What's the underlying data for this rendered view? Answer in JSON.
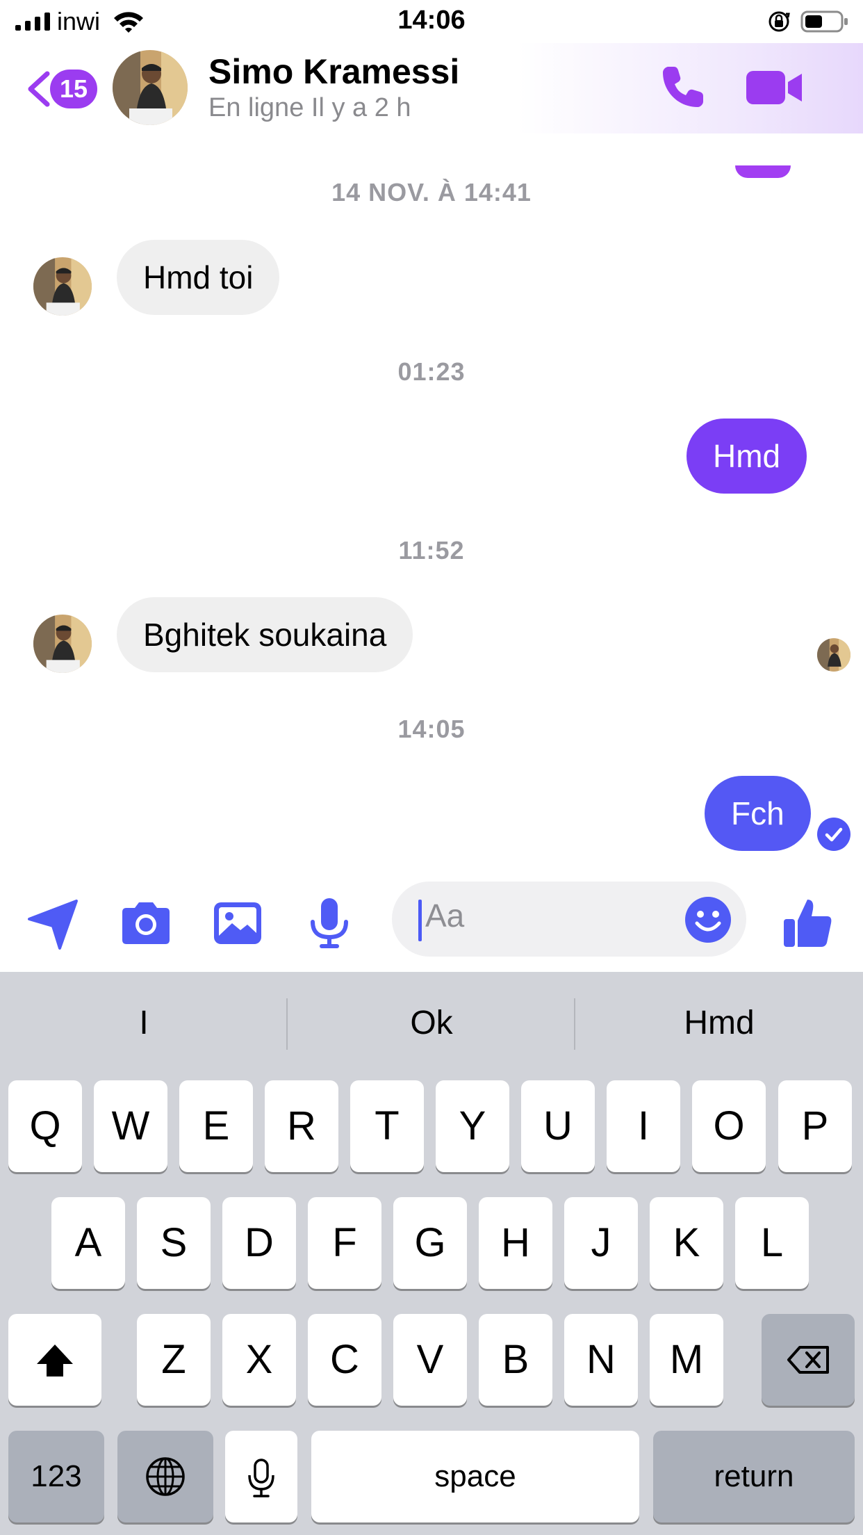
{
  "status_bar": {
    "carrier": "inwi",
    "time": "14:06"
  },
  "header": {
    "back_badge": "15",
    "contact_name": "Simo Kramessi",
    "contact_status": "En ligne Il y a 2 h",
    "accent_color": "#9b3cf0"
  },
  "messages": {
    "timestamps": [
      "14 NOV. À 14:41",
      "01:23",
      "11:52",
      "14:05"
    ],
    "items": [
      {
        "direction": "incoming",
        "text": "Hmd toi"
      },
      {
        "direction": "outgoing",
        "text": "Hmd",
        "color": "#7b3ef5"
      },
      {
        "direction": "incoming",
        "text": "Bghitek soukaina"
      },
      {
        "direction": "outgoing",
        "text": "Fch",
        "color": "#5458f4"
      }
    ]
  },
  "composer": {
    "placeholder": "Aa",
    "icons": [
      "location-arrow-icon",
      "camera-icon",
      "image-icon",
      "microphone-icon",
      "emoji-icon",
      "thumbs-up-icon"
    ],
    "icon_color": "#4f5bf5"
  },
  "keyboard": {
    "predictions": [
      "I",
      "Ok",
      "Hmd"
    ],
    "row1": [
      "Q",
      "W",
      "E",
      "R",
      "T",
      "Y",
      "U",
      "I",
      "O",
      "P"
    ],
    "row2": [
      "A",
      "S",
      "D",
      "F",
      "G",
      "H",
      "J",
      "K",
      "L"
    ],
    "row3": [
      "Z",
      "X",
      "C",
      "V",
      "B",
      "N",
      "M"
    ],
    "numbers_key": "123",
    "space_key": "space",
    "return_key": "return"
  }
}
